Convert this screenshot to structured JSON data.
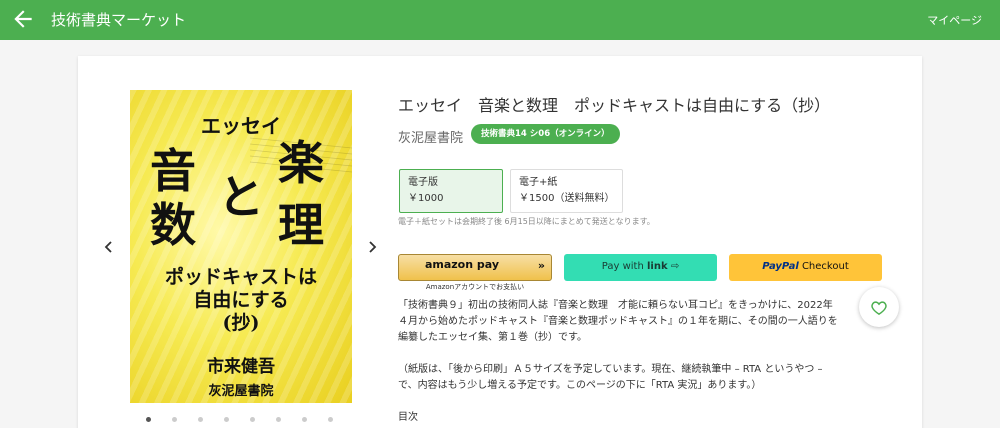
{
  "header": {
    "title": "技術書典マーケット",
    "mypage_label": "マイページ",
    "back_icon": "arrow-left-icon",
    "color": "#4caf50"
  },
  "cover": {
    "subtitle": "エッセイ",
    "title_chars": [
      "音",
      "楽",
      "と",
      "数",
      "理"
    ],
    "podcast_line1": "ポッドキャストは",
    "podcast_line2": "自由にする",
    "podcast_line3": "(抄)",
    "author": "市来健吾",
    "publisher": "灰泥屋書院",
    "dot_count": 8,
    "active_dot": 0
  },
  "product": {
    "title": "エッセイ　音楽と数理　ポッドキャストは自由にする（抄）",
    "publisher": "灰泥屋書院",
    "event_badge": "技術書典14 シ06（オンライン）"
  },
  "formats": [
    {
      "name": "電子版",
      "price": "￥1000",
      "selected": true
    },
    {
      "name": "電子+紙",
      "price": "￥1500（送料無料）",
      "selected": false
    }
  ],
  "format_note": "電子＋紙セットは会期終了後 6月15日以降にまとめて発送となります。",
  "payment": {
    "amazon_label": "amazon pay",
    "amazon_note": "Amazonアカウントでお支払い",
    "link_prefix": "Pay with",
    "link_brand": "link",
    "link_arrow": "⇨",
    "paypal_brand": "PayPal",
    "paypal_label": "Checkout"
  },
  "description": [
    "「技術書典９」初出の技術同人誌『音楽と数理　才能に頼らない耳コピ』をきっかけに、2022年４月から始めたポッドキャスト『音楽と数理ポッドキャスト』の１年を期に、その間の一人語りを編纂したエッセイ集、第１巻（抄）です。",
    "",
    "（紙版は、「後から印刷」Ａ５サイズを予定しています。現在、継続執筆中 – RTA というやつ – で、内容はもう少し増える予定です。このページの下に「RTA 実況」あります。）",
    "",
    "目次"
  ]
}
